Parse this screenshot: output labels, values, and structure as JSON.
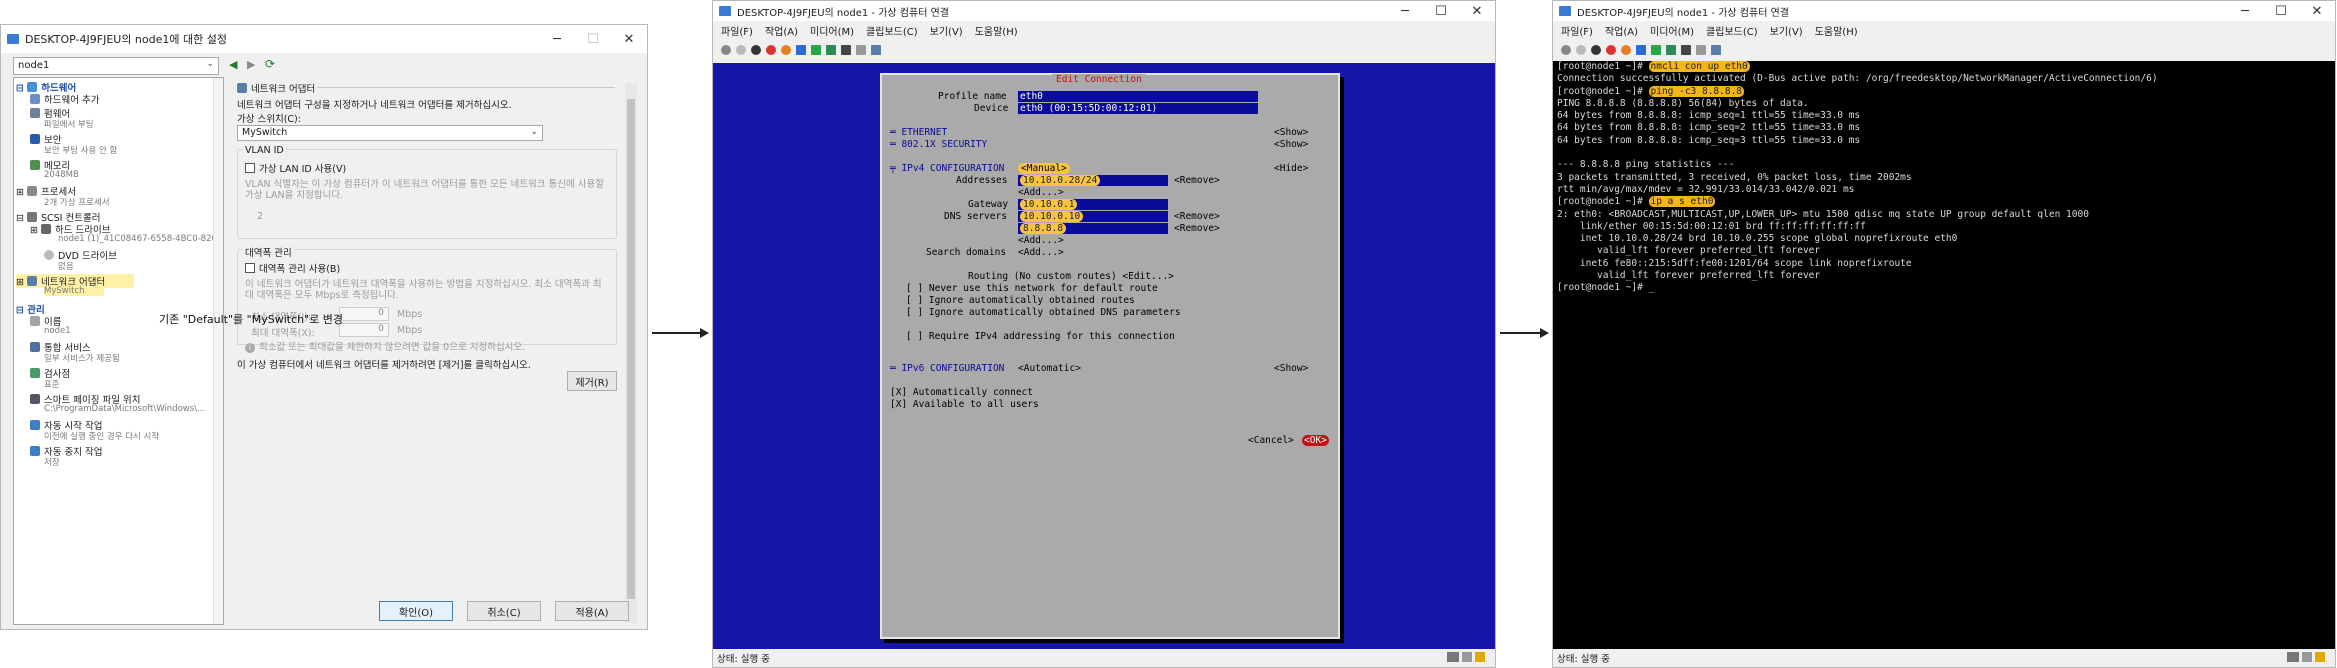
{
  "settings": {
    "title": "DESKTOP-4J9FJEU의 node1에 대한 설정",
    "vm_select": "node1",
    "tree": {
      "hardware_header": "하드웨어",
      "add_hardware": "하드웨어 추가",
      "firmware": "펌웨어",
      "firmware_sub": "파일에서 부팅",
      "security": "보안",
      "security_sub": "보안 부팅 사용 안 함",
      "memory": "메모리",
      "memory_sub": "2048MB",
      "processor": "프로세서",
      "processor_sub": "2개 가상 프로세서",
      "scsi": "SCSI 컨트롤러",
      "hdd": "하드 드라이브",
      "hdd_sub": "node1 (1)_41C08467-6558-4BC0-826...",
      "dvd": "DVD 드라이브",
      "dvd_sub": "없음",
      "nic": "네트워크 어댑터",
      "nic_sub": "MySwitch",
      "mgmt_header": "관리",
      "name": "이름",
      "name_sub": "node1",
      "integration": "통합 서비스",
      "integration_sub": "일부 서비스가 제공됨",
      "checkpoint": "검사점",
      "checkpoint_sub": "표준",
      "paging": "스마트 페이징 파일 위치",
      "paging_sub": "C:\\ProgramData\\Microsoft\\Windows\\...",
      "autostart": "자동 시작 작업",
      "autostart_sub": "이전에 실행 중인 경우 다시 시작",
      "autostop": "자동 중지 작업",
      "autostop_sub": "저장"
    },
    "panel": {
      "heading": "네트워크 어댑터",
      "desc": "네트워크 어댑터 구성을 지정하거나 네트워크 어댑터를 제거하십시오.",
      "vswitch_label": "가상 스위치(C):",
      "vswitch_value": "MySwitch",
      "vlan_header": "VLAN ID",
      "vlan_check": "가상 LAN ID 사용(V)",
      "vlan_desc": "VLAN 식별자는 이 가상 컴퓨터가 이 네트워크 어댑터를 통한 모든 네트워크 통신에 사용할 가상 LAN을 지정합니다.",
      "vlan_value": "2",
      "bw_header": "대역폭 관리",
      "bw_check": "대역폭 관리 사용(B)",
      "bw_desc": "이 네트워크 어댑터가 네트워크 대역폭을 사용하는 방법을 지정하십시오. 최소 대역폭과 최대 대역폭은 모두 Mbps로 측정됩니다.",
      "bw_min": "최소 대역폭(I):",
      "bw_max": "최대 대역폭(X):",
      "bw_min_val": "0",
      "bw_max_val": "0",
      "unit": "Mbps",
      "bw_note": "최소값 또는 최대값을 제한하지 않으려면 값을 0으로 지정하십시오.",
      "remove_desc": "이 가상 컴퓨터에서 네트워크 어댑터를 제거하려면 [제거]를 클릭하십시오.",
      "remove_btn": "제거(R)"
    },
    "buttons": {
      "ok": "확인(O)",
      "cancel": "취소(C)",
      "apply": "적용(A)"
    },
    "annotation": "기존 \"Default\"를 \"MySwitch\"로 변경"
  },
  "vm1": {
    "title": "DESKTOP-4J9FJEU의 node1 - 가상 컴퓨터 연결",
    "menu": [
      "파일(F)",
      "작업(A)",
      "미디어(M)",
      "클립보드(C)",
      "보기(V)",
      "도움말(H)"
    ],
    "status": "상태: 실행 중",
    "tui": {
      "title": "Edit Connection",
      "profile_label": "Profile name",
      "profile_value": "eth0",
      "device_label": "Device",
      "device_value": "eth0 (00:15:5D:00:12:01)",
      "ethernet": "═ ETHERNET",
      "security": "═ 802.1X SECURITY",
      "show": "<Show>",
      "hide": "<Hide>",
      "ipv4": "╤ IPv4 CONFIGURATION",
      "ipv4_mode": "<Manual>",
      "addresses_label": "Addresses",
      "address_value": "10.10.0.28/24",
      "remove": "<Remove>",
      "add": "<Add...>",
      "gateway_label": "Gateway",
      "gateway_value": "10.10.0.1",
      "dns_label": "DNS servers",
      "dns1": "10.10.0.10",
      "dns2": "8.8.8.8",
      "search_label": "Search domains",
      "routing": "Routing (No custom routes) <Edit...>",
      "opt1": "[ ] Never use this network for default route",
      "opt2": "[ ] Ignore automatically obtained routes",
      "opt3": "[ ] Ignore automatically obtained DNS parameters",
      "opt4": "[ ] Require IPv4 addressing for this connection",
      "ipv6": "═ IPv6 CONFIGURATION",
      "ipv6_mode": "<Automatic>",
      "auto": "[X] Automatically connect",
      "all_users": "[X] Available to all users",
      "cancel": "<Cancel>",
      "ok": "<OK>"
    }
  },
  "vm2": {
    "title": "DESKTOP-4J9FJEU의 node1 - 가상 컴퓨터 연결",
    "menu": [
      "파일(F)",
      "작업(A)",
      "미디어(M)",
      "클립보드(C)",
      "보기(V)",
      "도움말(H)"
    ],
    "status": "상태: 실행 중",
    "terminal": {
      "l0_prompt": "[root@node1 ~]# ",
      "l0_cmd": "nmcli con up eth0",
      "l1": "Connection successfully activated (D-Bus active path: /org/freedesktop/NetworkManager/ActiveConnection/6)",
      "l2_prompt": "[root@node1 ~]# ",
      "l2_cmd": "ping -c3 8.8.8.8",
      "l3": "PING 8.8.8.8 (8.8.8.8) 56(84) bytes of data.",
      "l4": "64 bytes from 8.8.8.8: icmp_seq=1 ttl=55 time=33.0 ms",
      "l5": "64 bytes from 8.8.8.8: icmp_seq=2 ttl=55 time=33.0 ms",
      "l6": "64 bytes from 8.8.8.8: icmp_seq=3 ttl=55 time=33.0 ms",
      "l7": "",
      "l8": "--- 8.8.8.8 ping statistics ---",
      "l9": "3 packets transmitted, 3 received, 0% packet loss, time 2002ms",
      "l10": "rtt min/avg/max/mdev = 32.991/33.014/33.042/0.021 ms",
      "l11_prompt": "[root@node1 ~]# ",
      "l11_cmd": "ip a s eth0",
      "l12": "2: eth0: <BROADCAST,MULTICAST,UP,LOWER_UP> mtu 1500 qdisc mq state UP group default qlen 1000",
      "l13": "    link/ether 00:15:5d:00:12:01 brd ff:ff:ff:ff:ff:ff",
      "l14": "    inet 10.10.0.28/24 brd 10.10.0.255 scope global noprefixroute eth0",
      "l15": "       valid_lft forever preferred_lft forever",
      "l16": "    inet6 fe80::215:5dff:fe00:1201/64 scope link noprefixroute",
      "l17": "       valid_lft forever preferred_lft forever",
      "l18": "[root@node1 ~]# _"
    }
  }
}
